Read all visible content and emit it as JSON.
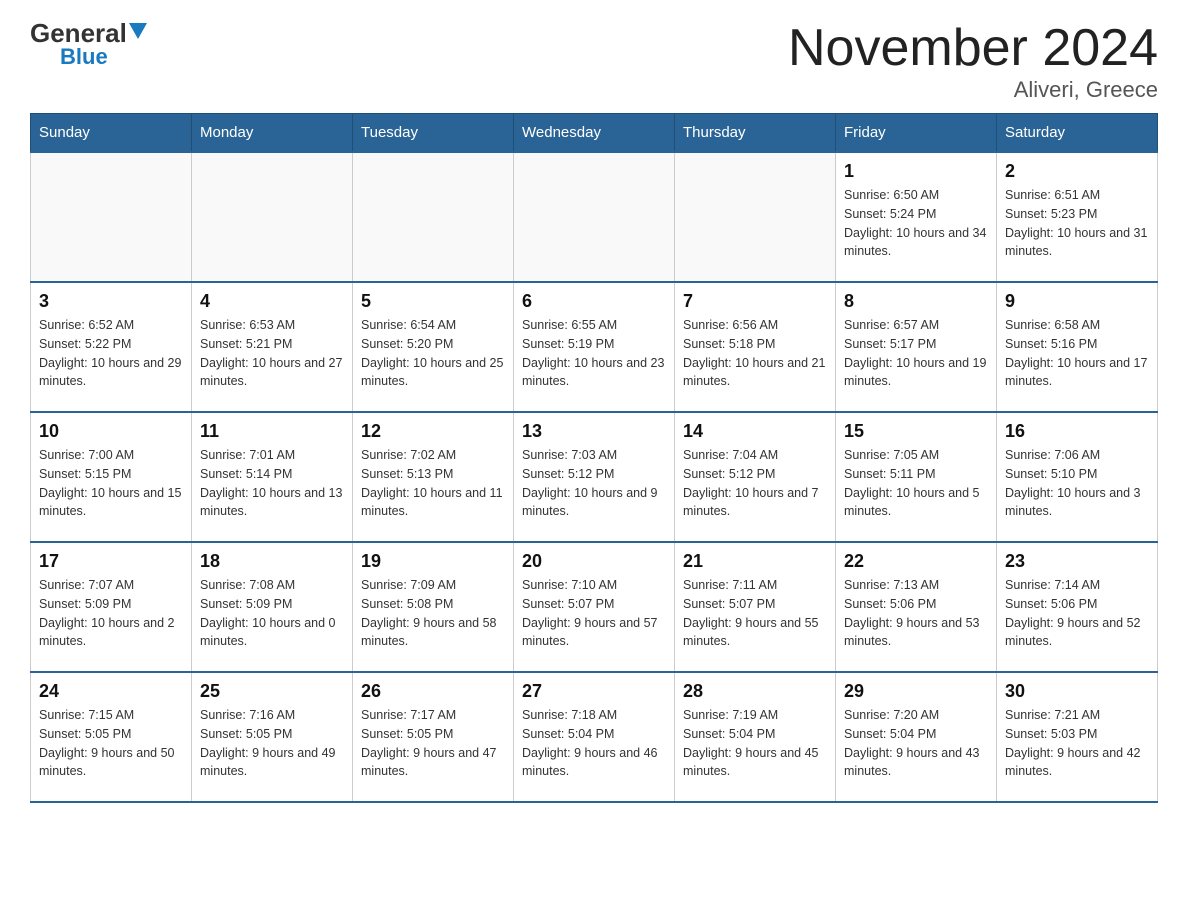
{
  "header": {
    "logo_general": "General",
    "logo_blue": "Blue",
    "month_title": "November 2024",
    "location": "Aliveri, Greece"
  },
  "days_of_week": [
    "Sunday",
    "Monday",
    "Tuesday",
    "Wednesday",
    "Thursday",
    "Friday",
    "Saturday"
  ],
  "weeks": [
    [
      {
        "day": "",
        "info": ""
      },
      {
        "day": "",
        "info": ""
      },
      {
        "day": "",
        "info": ""
      },
      {
        "day": "",
        "info": ""
      },
      {
        "day": "",
        "info": ""
      },
      {
        "day": "1",
        "info": "Sunrise: 6:50 AM\nSunset: 5:24 PM\nDaylight: 10 hours and 34 minutes."
      },
      {
        "day": "2",
        "info": "Sunrise: 6:51 AM\nSunset: 5:23 PM\nDaylight: 10 hours and 31 minutes."
      }
    ],
    [
      {
        "day": "3",
        "info": "Sunrise: 6:52 AM\nSunset: 5:22 PM\nDaylight: 10 hours and 29 minutes."
      },
      {
        "day": "4",
        "info": "Sunrise: 6:53 AM\nSunset: 5:21 PM\nDaylight: 10 hours and 27 minutes."
      },
      {
        "day": "5",
        "info": "Sunrise: 6:54 AM\nSunset: 5:20 PM\nDaylight: 10 hours and 25 minutes."
      },
      {
        "day": "6",
        "info": "Sunrise: 6:55 AM\nSunset: 5:19 PM\nDaylight: 10 hours and 23 minutes."
      },
      {
        "day": "7",
        "info": "Sunrise: 6:56 AM\nSunset: 5:18 PM\nDaylight: 10 hours and 21 minutes."
      },
      {
        "day": "8",
        "info": "Sunrise: 6:57 AM\nSunset: 5:17 PM\nDaylight: 10 hours and 19 minutes."
      },
      {
        "day": "9",
        "info": "Sunrise: 6:58 AM\nSunset: 5:16 PM\nDaylight: 10 hours and 17 minutes."
      }
    ],
    [
      {
        "day": "10",
        "info": "Sunrise: 7:00 AM\nSunset: 5:15 PM\nDaylight: 10 hours and 15 minutes."
      },
      {
        "day": "11",
        "info": "Sunrise: 7:01 AM\nSunset: 5:14 PM\nDaylight: 10 hours and 13 minutes."
      },
      {
        "day": "12",
        "info": "Sunrise: 7:02 AM\nSunset: 5:13 PM\nDaylight: 10 hours and 11 minutes."
      },
      {
        "day": "13",
        "info": "Sunrise: 7:03 AM\nSunset: 5:12 PM\nDaylight: 10 hours and 9 minutes."
      },
      {
        "day": "14",
        "info": "Sunrise: 7:04 AM\nSunset: 5:12 PM\nDaylight: 10 hours and 7 minutes."
      },
      {
        "day": "15",
        "info": "Sunrise: 7:05 AM\nSunset: 5:11 PM\nDaylight: 10 hours and 5 minutes."
      },
      {
        "day": "16",
        "info": "Sunrise: 7:06 AM\nSunset: 5:10 PM\nDaylight: 10 hours and 3 minutes."
      }
    ],
    [
      {
        "day": "17",
        "info": "Sunrise: 7:07 AM\nSunset: 5:09 PM\nDaylight: 10 hours and 2 minutes."
      },
      {
        "day": "18",
        "info": "Sunrise: 7:08 AM\nSunset: 5:09 PM\nDaylight: 10 hours and 0 minutes."
      },
      {
        "day": "19",
        "info": "Sunrise: 7:09 AM\nSunset: 5:08 PM\nDaylight: 9 hours and 58 minutes."
      },
      {
        "day": "20",
        "info": "Sunrise: 7:10 AM\nSunset: 5:07 PM\nDaylight: 9 hours and 57 minutes."
      },
      {
        "day": "21",
        "info": "Sunrise: 7:11 AM\nSunset: 5:07 PM\nDaylight: 9 hours and 55 minutes."
      },
      {
        "day": "22",
        "info": "Sunrise: 7:13 AM\nSunset: 5:06 PM\nDaylight: 9 hours and 53 minutes."
      },
      {
        "day": "23",
        "info": "Sunrise: 7:14 AM\nSunset: 5:06 PM\nDaylight: 9 hours and 52 minutes."
      }
    ],
    [
      {
        "day": "24",
        "info": "Sunrise: 7:15 AM\nSunset: 5:05 PM\nDaylight: 9 hours and 50 minutes."
      },
      {
        "day": "25",
        "info": "Sunrise: 7:16 AM\nSunset: 5:05 PM\nDaylight: 9 hours and 49 minutes."
      },
      {
        "day": "26",
        "info": "Sunrise: 7:17 AM\nSunset: 5:05 PM\nDaylight: 9 hours and 47 minutes."
      },
      {
        "day": "27",
        "info": "Sunrise: 7:18 AM\nSunset: 5:04 PM\nDaylight: 9 hours and 46 minutes."
      },
      {
        "day": "28",
        "info": "Sunrise: 7:19 AM\nSunset: 5:04 PM\nDaylight: 9 hours and 45 minutes."
      },
      {
        "day": "29",
        "info": "Sunrise: 7:20 AM\nSunset: 5:04 PM\nDaylight: 9 hours and 43 minutes."
      },
      {
        "day": "30",
        "info": "Sunrise: 7:21 AM\nSunset: 5:03 PM\nDaylight: 9 hours and 42 minutes."
      }
    ]
  ]
}
